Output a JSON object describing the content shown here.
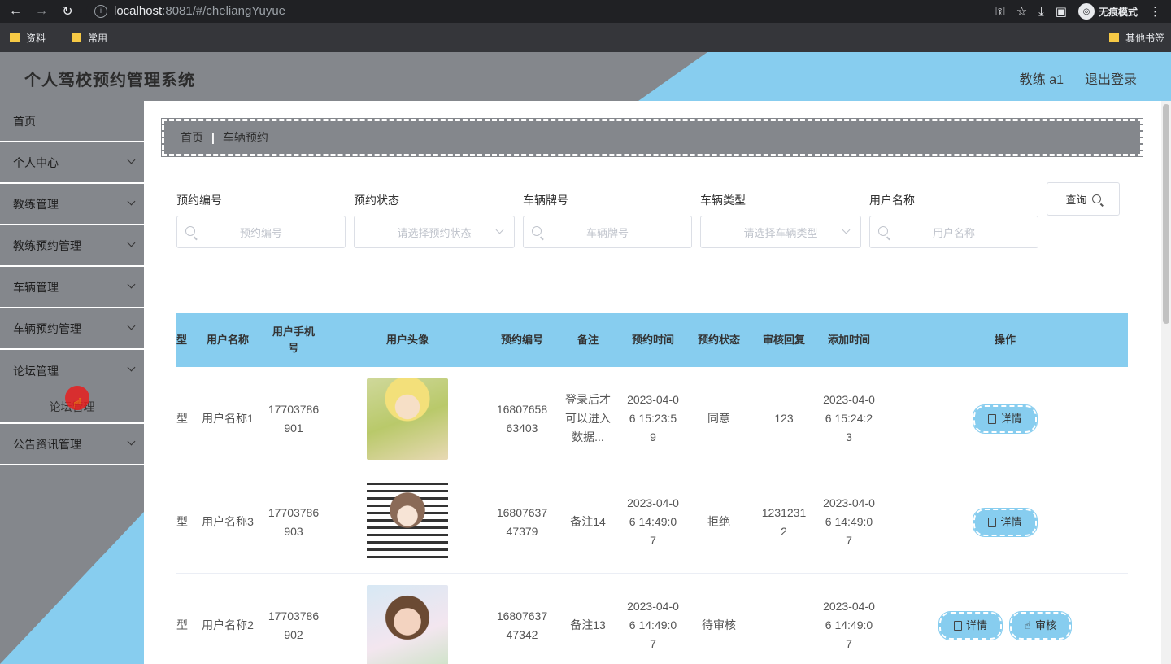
{
  "browser": {
    "url_host": "localhost",
    "url_rest": ":8081/#/cheliangYuyue",
    "incognito_label": "无痕模式",
    "bookmarks": [
      "资料",
      "常用"
    ],
    "other_bookmarks": "其他书签"
  },
  "header": {
    "title": "个人驾校预约管理系统",
    "user": "教练 a1",
    "logout": "退出登录"
  },
  "sidebar": {
    "items": [
      {
        "label": "首页"
      },
      {
        "label": "个人中心"
      },
      {
        "label": "教练管理"
      },
      {
        "label": "教练预约管理"
      },
      {
        "label": "车辆管理"
      },
      {
        "label": "车辆预约管理"
      },
      {
        "label": "论坛管理"
      },
      {
        "label": "论坛管理"
      },
      {
        "label": "公告资讯管理"
      }
    ]
  },
  "breadcrumb": {
    "home": "首页",
    "current": "车辆预约"
  },
  "filters": {
    "f1": {
      "label": "预约编号",
      "placeholder": "预约编号"
    },
    "f2": {
      "label": "预约状态",
      "placeholder": "请选择预约状态"
    },
    "f3": {
      "label": "车辆牌号",
      "placeholder": "车辆牌号"
    },
    "f4": {
      "label": "车辆类型",
      "placeholder": "请选择车辆类型"
    },
    "f5": {
      "label": "用户名称",
      "placeholder": "用户名称"
    },
    "query": "查询"
  },
  "table": {
    "headers": {
      "c0": "型",
      "c1": "用户名称",
      "c2": "用户手机号",
      "c3": "用户头像",
      "c4": "预约编号",
      "c5": "备注",
      "c6": "预约时间",
      "c7": "预约状态",
      "c8": "审核回复",
      "c9": "添加时间",
      "c10": "操作"
    },
    "rows": [
      {
        "c0": "型",
        "c1": "用户名称1",
        "c2": "17703786901",
        "c4": "1680765863403",
        "c5": "登录后才可以进入数据...",
        "c6": "2023-04-06 15:23:59",
        "c7": "同意",
        "c8": "123",
        "c9": "2023-04-06 15:24:23",
        "detail": "详情"
      },
      {
        "c0": "型",
        "c1": "用户名称3",
        "c2": "17703786903",
        "c4": "1680763747379",
        "c5": "备注14",
        "c6": "2023-04-06 14:49:07",
        "c7": "拒绝",
        "c8": "12312312",
        "c9": "2023-04-06 14:49:07",
        "detail": "详情"
      },
      {
        "c0": "型",
        "c1": "用户名称2",
        "c2": "17703786902",
        "c4": "1680763747342",
        "c5": "备注13",
        "c6": "2023-04-06 14:49:07",
        "c7": "待审核",
        "c8": "",
        "c9": "2023-04-06 14:49:07",
        "detail": "详情",
        "review": "审核"
      }
    ]
  }
}
